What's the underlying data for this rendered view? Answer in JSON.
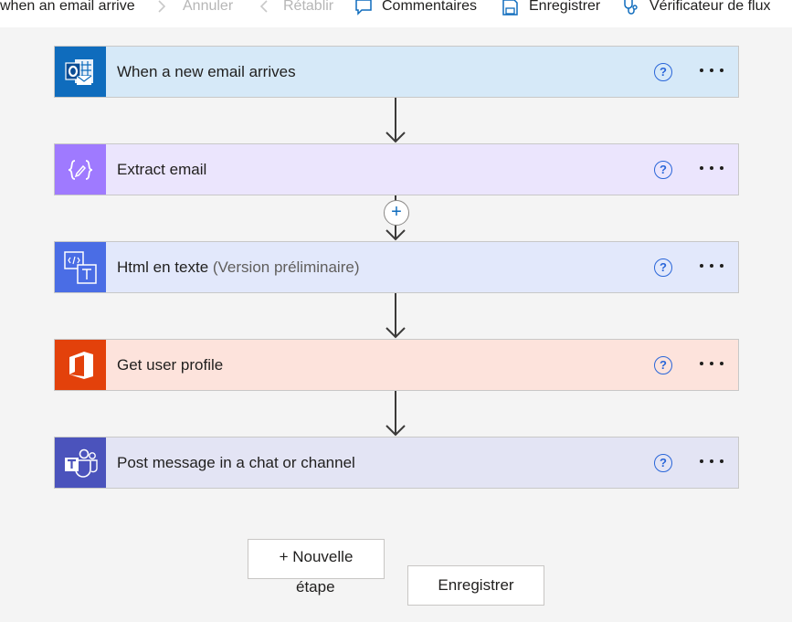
{
  "toolbar": {
    "flow_title": "when an email arrive",
    "undo_label": "Annuler",
    "redo_label": "Rétablir",
    "comments_label": "Commentaires",
    "save_label": "Enregistrer",
    "checker_label": "Vérificateur de flux"
  },
  "steps": [
    {
      "label": "When a new email arrives",
      "sub": "",
      "icon": "outlook-icon",
      "color": "#0f6cbd"
    },
    {
      "label": "Extract email",
      "sub": "",
      "icon": "data-operation-icon",
      "color": "#9f7aff"
    },
    {
      "label": "Html en texte ",
      "sub": "(Version préliminaire)",
      "icon": "html-to-text-icon",
      "color": "#4a6de5"
    },
    {
      "label": "Get user profile",
      "sub": "",
      "icon": "office365-icon",
      "color": "#e3410b"
    },
    {
      "label": "Post message in a chat or channel",
      "sub": "",
      "icon": "teams-icon",
      "color": "#4b53bc"
    }
  ],
  "step_help": "?",
  "insert_step": "+",
  "buttons": {
    "new_step_line1": "+ Nouvelle",
    "new_step_line2": "étape",
    "save": "Enregistrer"
  }
}
